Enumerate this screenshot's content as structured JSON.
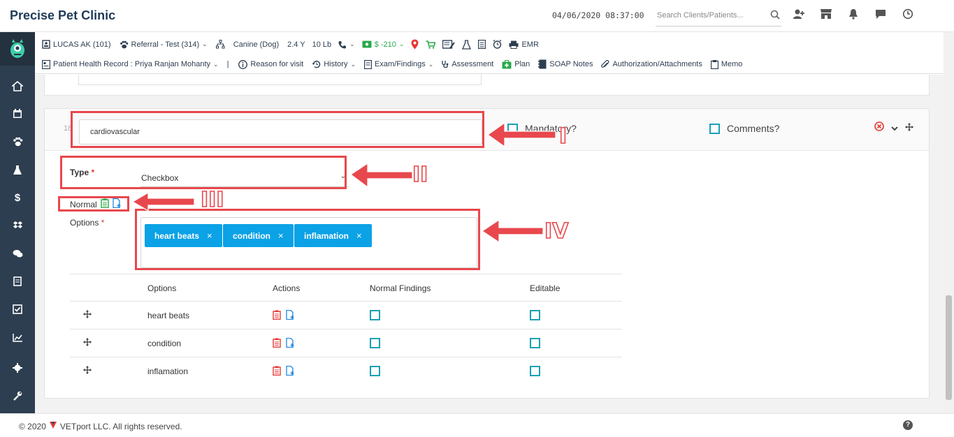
{
  "app": {
    "title": "Precise Pet Clinic",
    "datetime": "04/06/2020 08:37:00"
  },
  "search": {
    "placeholder": "Search Clients/Patients..."
  },
  "patient_bar": {
    "client": "LUCAS AK (101)",
    "referral": "Referral - Test (314)",
    "species": "Canine (Dog)",
    "age": "2.4 Y",
    "weight": "10 Lb",
    "balance": "$ -210",
    "emr": "EMR"
  },
  "record_bar": {
    "patient_record": "Patient Health Record : Priya Ranjan Mohanty",
    "separator": "|",
    "reason": "Reason for visit",
    "history": "History",
    "exam": "Exam/Findings",
    "assessment": "Assessment",
    "plan": "Plan",
    "soap": "SOAP Notes",
    "auth": "Authorization/Attachments",
    "memo": "Memo"
  },
  "question": {
    "row_number": "18",
    "text": "cardiovascular",
    "mandatory_label": "Mandatory?",
    "comments_label": "Comments?",
    "type_label": "Type",
    "required_mark": "*",
    "type_value": "Checkbox",
    "normal_label": "Normal",
    "options_label": "Options",
    "chips": [
      "heart beats",
      "condition",
      "inflamation"
    ],
    "chip_remove": "×"
  },
  "options_table": {
    "headers": [
      "Options",
      "Actions",
      "Normal Findings",
      "Editable"
    ],
    "rows": [
      {
        "option": "heart beats"
      },
      {
        "option": "condition"
      },
      {
        "option": "inflamation"
      }
    ]
  },
  "annotations": {
    "labels": [
      "I",
      "II",
      "III",
      "IV"
    ],
    "color": "#e8484d"
  },
  "footer": {
    "copyright": "© 2020",
    "company": "VETport LLC. All rights reserved.",
    "help": "?"
  },
  "colors": {
    "accent": "#1ba0b5",
    "chip": "#0ba2e6",
    "sidebar": "#2d3e50",
    "danger": "#e53935"
  }
}
